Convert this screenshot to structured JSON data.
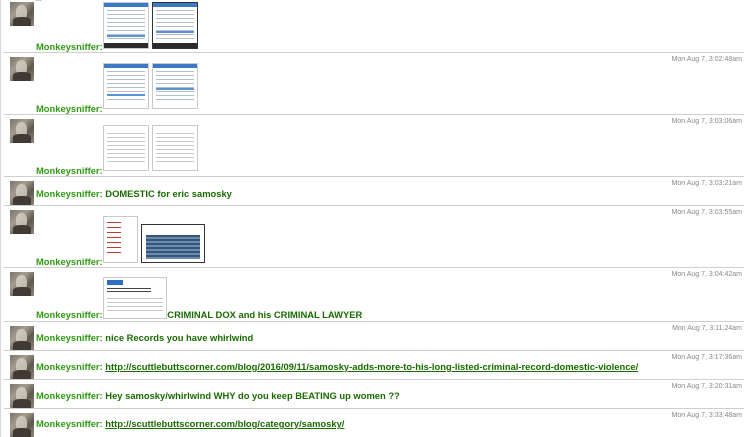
{
  "cutoff_text": "...",
  "messages": [
    {
      "author": "Monkeysniffer:",
      "timestamp": "",
      "text": ""
    },
    {
      "author": "Monkeysniffer:",
      "timestamp": "Mon Aug 7, 3:02:48am",
      "text": ""
    },
    {
      "author": "Monkeysniffer:",
      "timestamp": "Mon Aug 7, 3:03:06am",
      "text": ""
    },
    {
      "author": "Monkeysniffer:",
      "timestamp": "Mon Aug 7, 3:03:21am",
      "text": "DOMESTIC for eric samosky"
    },
    {
      "author": "Monkeysniffer:",
      "timestamp": "Mon Aug 7, 3:03:55am",
      "text": ""
    },
    {
      "author": "Monkeysniffer:",
      "timestamp": "Mon Aug 7, 3:04:42am",
      "text": "CRIMINAL DOX and his CRIMINAL LAWYER"
    },
    {
      "author": "Monkeysniffer:",
      "timestamp": "Mon Aug 7, 3:11:24am",
      "text": "nice Records you have whirlwind"
    },
    {
      "author": "Monkeysniffer:",
      "timestamp": "Mon Aug 7, 3:17:36am",
      "link": "http://scuttlebuttscorner.com/blog/2016/09/11/samosky-adds-more-to-his-long-listed-criminal-record-domestic-violence/"
    },
    {
      "author": "Monkeysniffer:",
      "timestamp": "Mon Aug 7, 3:20:31am",
      "text": "Hey samosky/whirlwind WHY do you keep BEATING up women ??"
    },
    {
      "author": "Monkeysniffer:",
      "timestamp": "Mon Aug 7, 3:33:48am",
      "link": "http://scuttlebuttscorner.com/blog/category/samosky/"
    }
  ]
}
